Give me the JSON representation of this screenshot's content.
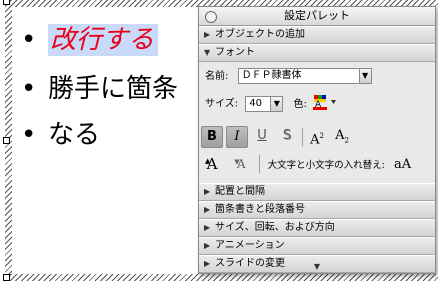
{
  "slide": {
    "lines": [
      "改行する",
      "勝手に箇条",
      "なる"
    ],
    "bullet": "•",
    "highlight_color": "#c9daf8",
    "red_text_color": "#e8001a"
  },
  "palette": {
    "title": "設定パレット",
    "sections_top": [
      {
        "label": "オブジェクトの追加",
        "state": "collapsed"
      },
      {
        "label": "フォント",
        "state": "expanded"
      }
    ],
    "font": {
      "name_label": "名前:",
      "name_value": "ＤＦＰ隷書体",
      "size_label": "サイズ:",
      "size_value": "40",
      "color_label": "色:",
      "bold": "B",
      "italic": "I",
      "underline": "U",
      "shadow": "S",
      "superscript": "A",
      "superscript_mark": "2",
      "subscript": "A",
      "subscript_mark": "2",
      "grow_glyph": "A",
      "shrink_glyph": "A",
      "case_label": "大文字と小文字の入れ替え:",
      "case_glyph": "aA"
    },
    "sections_bottom": [
      {
        "label": "配置と間隔",
        "state": "collapsed"
      },
      {
        "label": "箇条書きと段落番号",
        "state": "collapsed"
      },
      {
        "label": "サイズ、回転、および方向",
        "state": "collapsed"
      },
      {
        "label": "アニメーション",
        "state": "collapsed"
      },
      {
        "label": "スライドの変更",
        "state": "collapsed"
      }
    ]
  }
}
